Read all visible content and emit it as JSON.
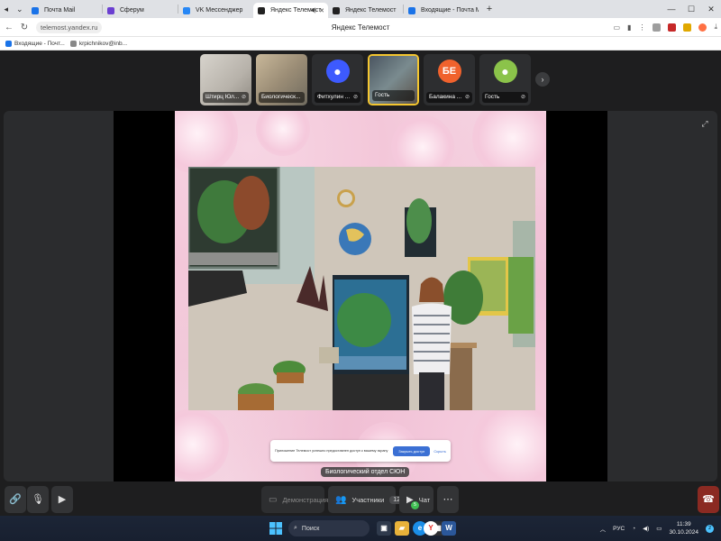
{
  "browser": {
    "tabs": [
      {
        "label": "Почта Mail",
        "favicon": "mail-icon",
        "color": "#1a73e8",
        "active": false
      },
      {
        "label": "Сферум",
        "favicon": "sferum-icon",
        "color": "#6b3fd1",
        "active": false
      },
      {
        "label": "VK Мессенджер",
        "favicon": "vk-icon",
        "color": "#2787f5",
        "active": false
      },
      {
        "label": "Яндекс Телемост",
        "favicon": "telemost-icon",
        "color": "#222222",
        "active": true
      },
      {
        "label": "Яндекс Телемост",
        "favicon": "telemost-icon",
        "color": "#222222",
        "active": false
      },
      {
        "label": "Входящие - Почта Mail",
        "favicon": "mail-icon",
        "color": "#1a73e8",
        "active": false
      }
    ],
    "url": "telemost.yandex.ru",
    "page_title": "Яндекс Телемост",
    "bookmarks": [
      {
        "label": "Входящие - Почт...",
        "color": "#1a73e8"
      },
      {
        "label": "krpichnikov@inb...",
        "color": "#888888"
      }
    ]
  },
  "meeting": {
    "participants": [
      {
        "name": "Штирц Юл...",
        "type": "video",
        "mic_off": true
      },
      {
        "name": "Биологическ...",
        "type": "video",
        "mic_off": false
      },
      {
        "name": "Фитхулин ...",
        "type": "avatar",
        "initials": "",
        "avatar_color": "#3d5afe",
        "mic_off": true
      },
      {
        "name": "Гость",
        "type": "video",
        "mic_off": false,
        "speaking": true
      },
      {
        "name": "Балакина ...",
        "type": "avatar",
        "initials": "БЕ",
        "avatar_color": "#f0622d",
        "mic_off": true
      },
      {
        "name": "Гость",
        "type": "avatar",
        "initials": "",
        "avatar_color": "#8bc34a",
        "mic_off": true
      }
    ],
    "share_banner": {
      "text": "Приложение Телемост успешно предоставлен доступ к вашему экрану",
      "share_button": "Закрыть доступ",
      "cancel": "Скрыть"
    },
    "stage_caption": "Биологический отдел СЮН",
    "controls": {
      "demo_label": "Демонстрация",
      "participants_label": "Участники",
      "participants_count": "12",
      "chat_label": "Чат",
      "chat_unread": "5"
    }
  },
  "taskbar": {
    "search_placeholder": "Поиск",
    "language": "РУС",
    "time": "11:39",
    "date": "30.10.2024"
  }
}
